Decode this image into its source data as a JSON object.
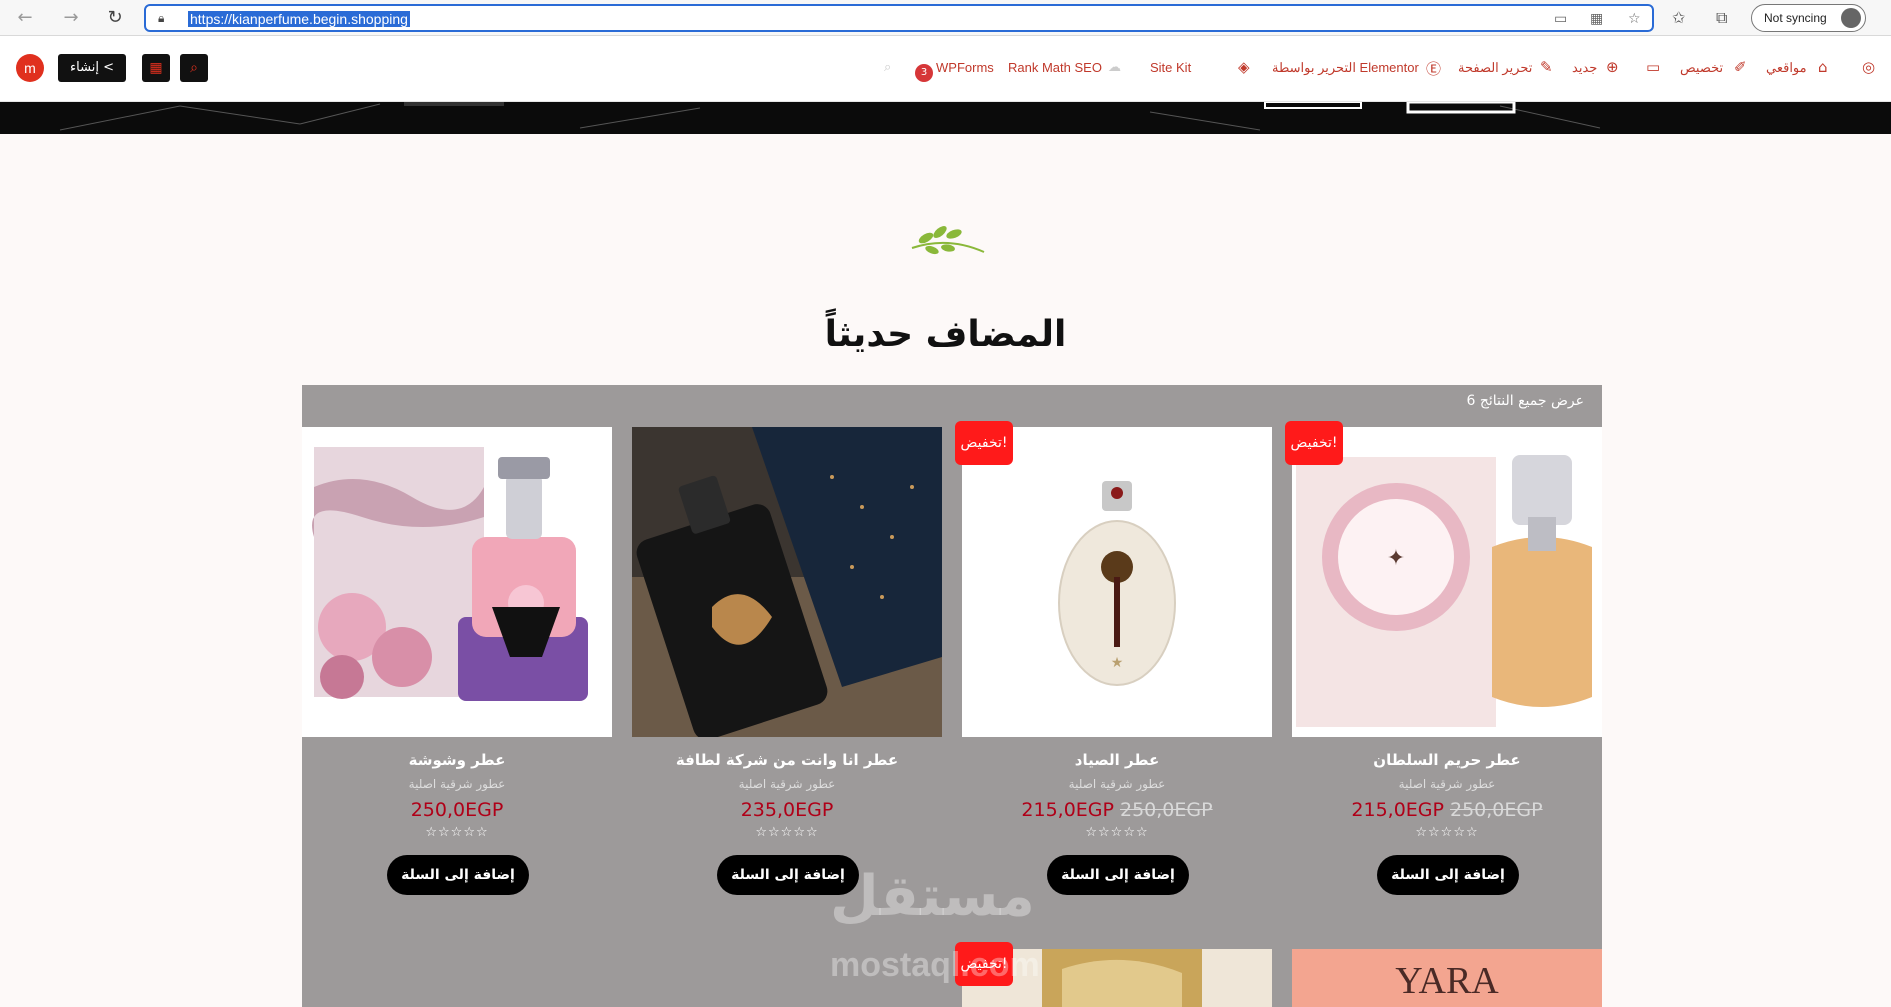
{
  "browser": {
    "url": "https://kianperfume.begin.shopping",
    "sync_label": "Not syncing"
  },
  "wpbar": {
    "avatar_letter": "m",
    "create_label": "إنشاء <",
    "items": {
      "my_sites": "مواقعي",
      "customize": "تخصيص",
      "new": "جديد",
      "edit_page": "تحرير الصفحة",
      "edit_elementor": "التحرير بواسطة Elementor",
      "site_kit": "Site Kit",
      "rank_math": "Rank Math SEO",
      "wpforms": "WPForms",
      "wpforms_badge": "3"
    }
  },
  "section": {
    "title": "المضاف حديثاً",
    "results_text": "عرض جميع النتائج 6"
  },
  "products": [
    {
      "name": "عطر وشوشة",
      "category": "عطور شرقية اصلية",
      "price": "250,0EGP",
      "old_price": "",
      "sale": "",
      "cart": "إضافة إلى السلة",
      "stars": "☆☆☆☆☆"
    },
    {
      "name": "عطر انا وانت من شركة لطافة",
      "category": "عطور شرقية اصلية",
      "price": "235,0EGP",
      "old_price": "",
      "sale": "",
      "cart": "إضافة إلى السلة",
      "stars": "☆☆☆☆☆"
    },
    {
      "name": "عطر الصياد",
      "category": "عطور شرقية اصلية",
      "price": "215,0EGP",
      "old_price": "250,0EGP",
      "sale": "تخفيض!",
      "cart": "إضافة إلى السلة",
      "stars": "☆☆☆☆☆"
    },
    {
      "name": "عطر حريم السلطان",
      "category": "عطور شرقية اصلية",
      "price": "215,0EGP",
      "old_price": "250,0EGP",
      "sale": "تخفيض!",
      "cart": "إضافة إلى السلة",
      "stars": "☆☆☆☆☆"
    }
  ],
  "next_row": {
    "sale": "تخفيض!",
    "yara_label": "YARA"
  },
  "watermark": {
    "arabic": "مستقل",
    "latin": "mostaql.com"
  },
  "colors": {
    "accent": "#e0301e",
    "sale_badge": "#ff1a1a",
    "price": "#b00018",
    "grid_bg": "#9d9a9a"
  }
}
